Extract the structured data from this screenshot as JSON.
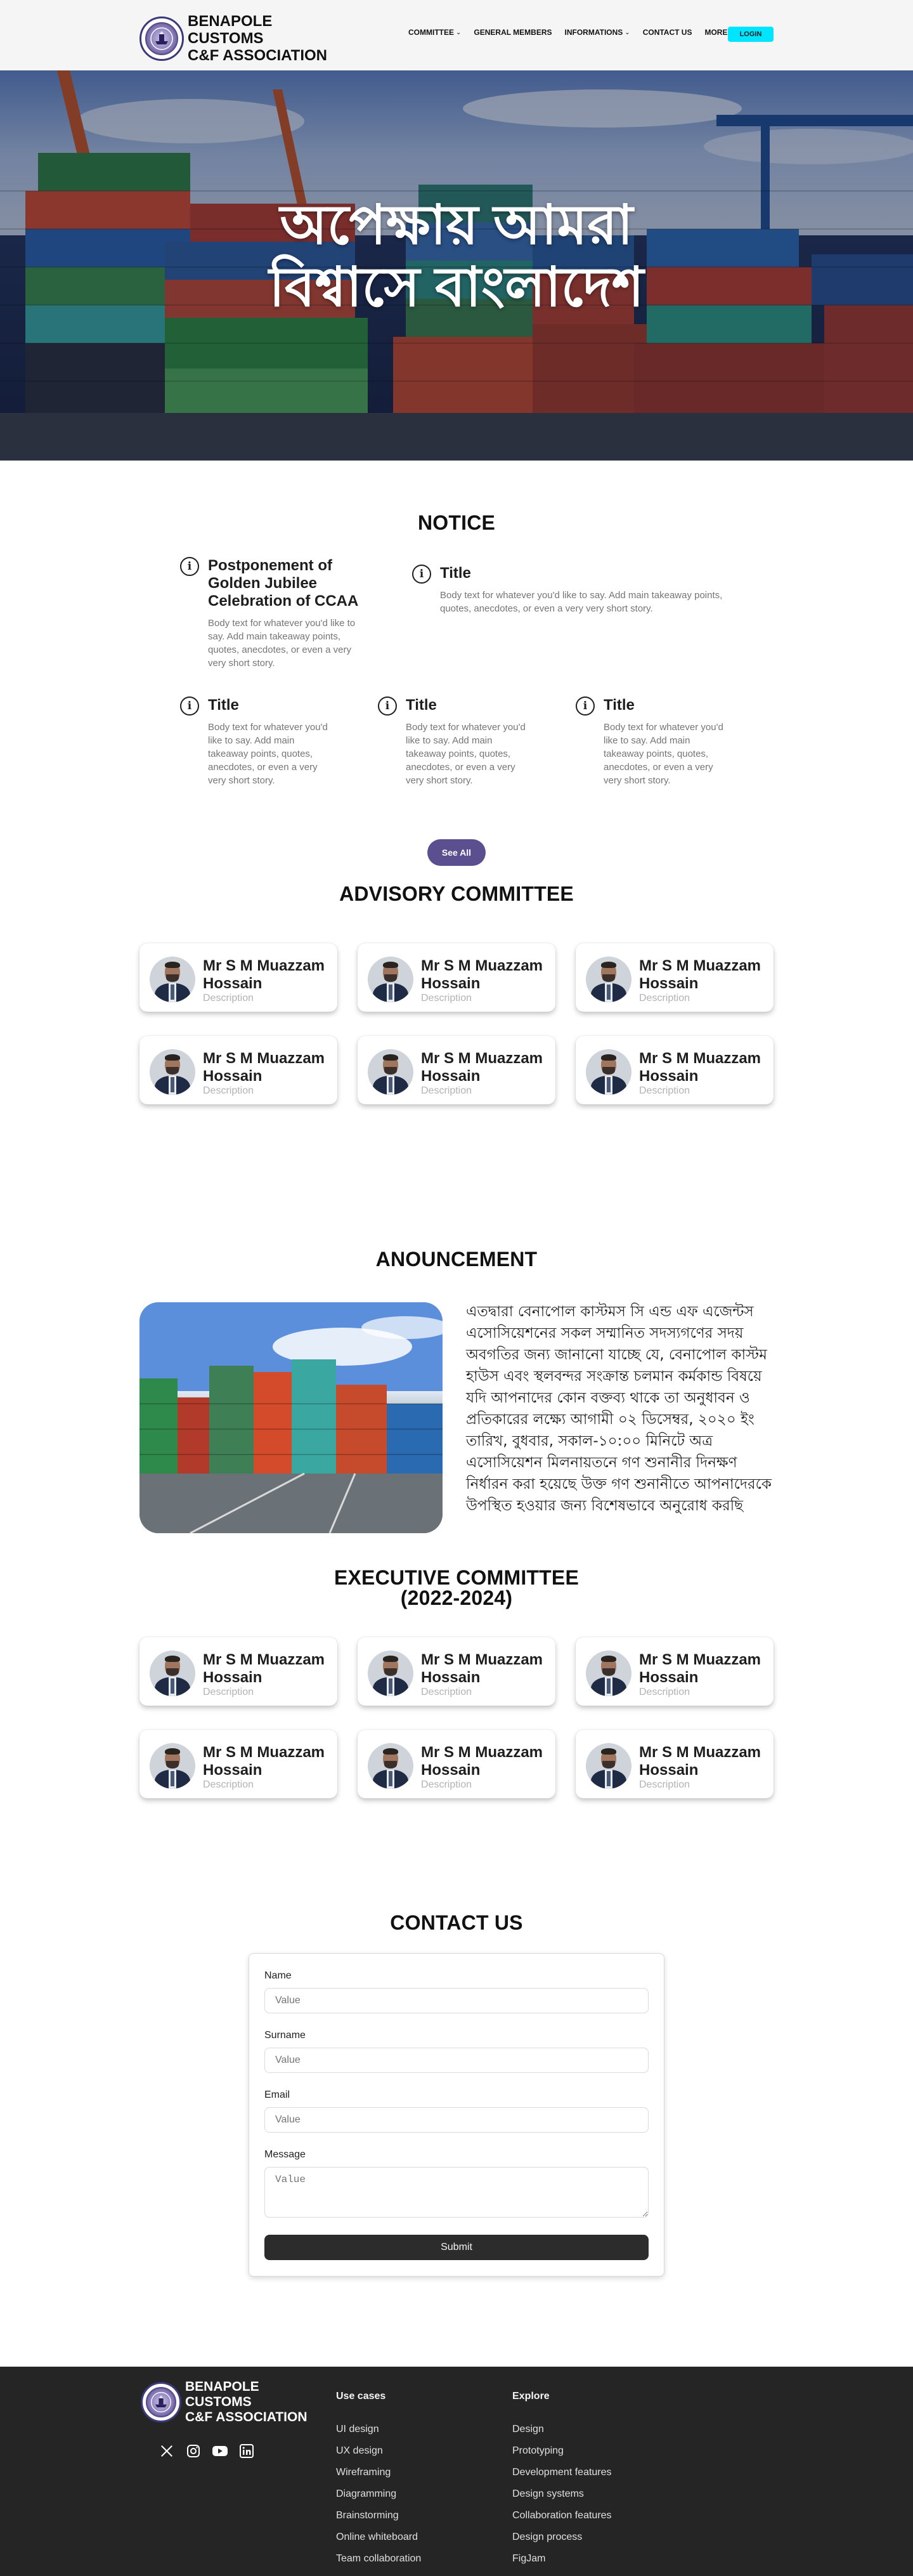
{
  "brand": {
    "name_lines": [
      "BENAPOLE",
      "CUSTOMS",
      "C&F ASSOCIATION"
    ],
    "logo_icon": "association-seal-logo"
  },
  "nav": {
    "items": [
      {
        "label": "COMMITTEE",
        "dropdown": true
      },
      {
        "label": "GENERAL MEMBERS",
        "dropdown": false
      },
      {
        "label": "INFORMATIONS",
        "dropdown": true
      },
      {
        "label": "CONTACT US",
        "dropdown": false
      },
      {
        "label": "MORE",
        "dropdown": true
      }
    ],
    "login_label": "LOGIN",
    "login_color": "#00e5ff"
  },
  "hero": {
    "line1": "অপেক্ষায় আমরা",
    "line2": "বিশ্বাসে বাংলাদেশ"
  },
  "notice": {
    "title": "NOTICE",
    "items": [
      {
        "title": "Postponement of Golden Jubilee Celebration of CCAA",
        "body": "Body text for whatever you'd like to say. Add main takeaway points, quotes, anecdotes, or even a very very short story."
      },
      {
        "title": "Title",
        "body": "Body text for whatever you'd like to say. Add main takeaway points, quotes, anecdotes, or even a very very short story."
      },
      {
        "title": "Title",
        "body": "Body text for whatever you'd like to say. Add main takeaway points, quotes, anecdotes, or even a very very short story."
      },
      {
        "title": "Title",
        "body": "Body text for whatever you'd like to say. Add main takeaway points, quotes, anecdotes, or even a very very short story."
      },
      {
        "title": "Title",
        "body": "Body text for whatever you'd like to say. Add main takeaway points, quotes, anecdotes, or even a very very short story."
      }
    ],
    "see_all_label": "See All",
    "accent": "#5b4f8f"
  },
  "advisory": {
    "title": "ADVISORY COMMITTEE",
    "members": [
      {
        "name": "Mr S M Muazzam Hossain",
        "desc": "Description"
      },
      {
        "name": "Mr S M Muazzam Hossain",
        "desc": "Description"
      },
      {
        "name": "Mr S M Muazzam Hossain",
        "desc": "Description"
      },
      {
        "name": "Mr S M Muazzam Hossain",
        "desc": "Description"
      },
      {
        "name": "Mr S M Muazzam Hossain",
        "desc": "Description"
      },
      {
        "name": "Mr S M Muazzam Hossain",
        "desc": "Description"
      }
    ]
  },
  "announcement": {
    "title": "ANOUNCEMENT",
    "text": "এতদ্বারা বেনাপোল কাস্টমস সি এন্ড এফ এজেন্টস এসোসিয়েশনের সকল সম্মানিত সদস্যগণের সদয় অবগতির জন্য জানানো যাচ্ছে যে, বেনাপোল কাস্টম হাউস এবং স্থলবন্দর সংক্রান্ত চলমান কর্মকান্ড বিষয়ে যদি আপনাদের কোন বক্তব্য থাকে তা অনুধাবন ও প্রতিকারের লক্ষ্যে আগামী ০২ ডিসেম্বর, ২০২০ ইং তারিখ, বুধবার, সকাল-১০:০০ মিনিটে অত্র এসোসিয়েশন মিলনায়তনে গণ শুনানীর দিনক্ষণ নির্ধারন করা হয়েছে উক্ত গণ শুনানীতে আপনাদেরকে উপস্থিত হওয়ার জন্য বিশেষভাবে অনুরোধ করছি"
  },
  "executive": {
    "title_line1": "EXECUTIVE COMMITTEE",
    "title_line2": "(2022-2024)",
    "members": [
      {
        "name": "Mr S M Muazzam Hossain",
        "desc": "Description"
      },
      {
        "name": "Mr S M Muazzam Hossain",
        "desc": "Description"
      },
      {
        "name": "Mr S M Muazzam Hossain",
        "desc": "Description"
      },
      {
        "name": "Mr S M Muazzam Hossain",
        "desc": "Description"
      },
      {
        "name": "Mr S M Muazzam Hossain",
        "desc": "Description"
      },
      {
        "name": "Mr S M Muazzam Hossain",
        "desc": "Description"
      }
    ]
  },
  "contact": {
    "title": "CONTACT US",
    "fields": [
      {
        "label": "Name",
        "placeholder": "Value"
      },
      {
        "label": "Surname",
        "placeholder": "Value"
      },
      {
        "label": "Email",
        "placeholder": "Value"
      },
      {
        "label": "Message",
        "placeholder": "Value"
      }
    ],
    "submit_label": "Submit"
  },
  "footer": {
    "socials": [
      "x-icon",
      "instagram-icon",
      "youtube-icon",
      "linkedin-icon"
    ],
    "col1": {
      "heading": "Use cases",
      "links": [
        "UI design",
        "UX design",
        "Wireframing",
        "Diagramming",
        "Brainstorming",
        "Online whiteboard",
        "Team collaboration"
      ]
    },
    "col2": {
      "heading": "Explore",
      "links": [
        "Design",
        "Prototyping",
        "Development features",
        "Design systems",
        "Collaboration features",
        "Design process",
        "FigJam"
      ]
    }
  }
}
